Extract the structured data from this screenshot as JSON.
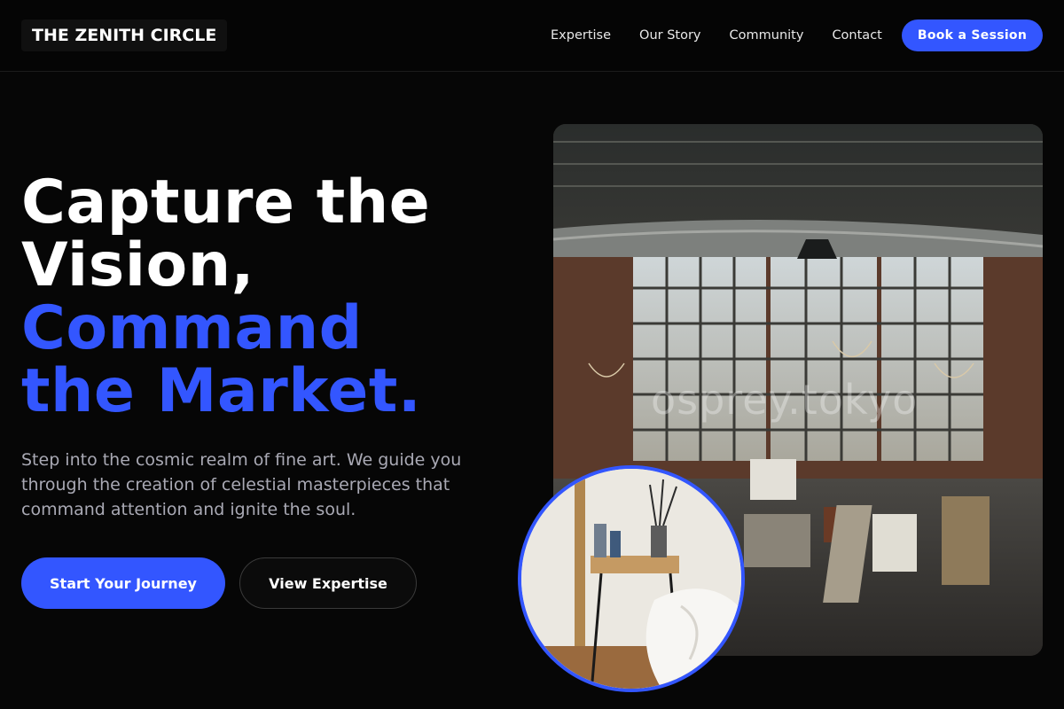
{
  "header": {
    "logo": "THE ZENITH CIRCLE",
    "nav": [
      "Expertise",
      "Our Story",
      "Community",
      "Contact"
    ],
    "cta_label": "Book a Session"
  },
  "hero": {
    "headline_line1": "Capture the",
    "headline_line2": "Vision,",
    "headline_line3": "Command",
    "headline_line4": "the Market.",
    "subtext": "Step into the cosmic realm of fine art. We guide you through the creation of celestial masterpieces that command attention and ignite the soul.",
    "primary_cta": "Start Your Journey",
    "secondary_cta": "View Expertise",
    "image_watermark": "osprey.tokyo",
    "image_subject": "art-studio-loft-photo",
    "inset_subject": "paintbrush-table-photo"
  },
  "colors": {
    "background": "#060606",
    "accent": "#3356ff",
    "text": "#ffffff",
    "muted_text": "#a9a9b4"
  }
}
